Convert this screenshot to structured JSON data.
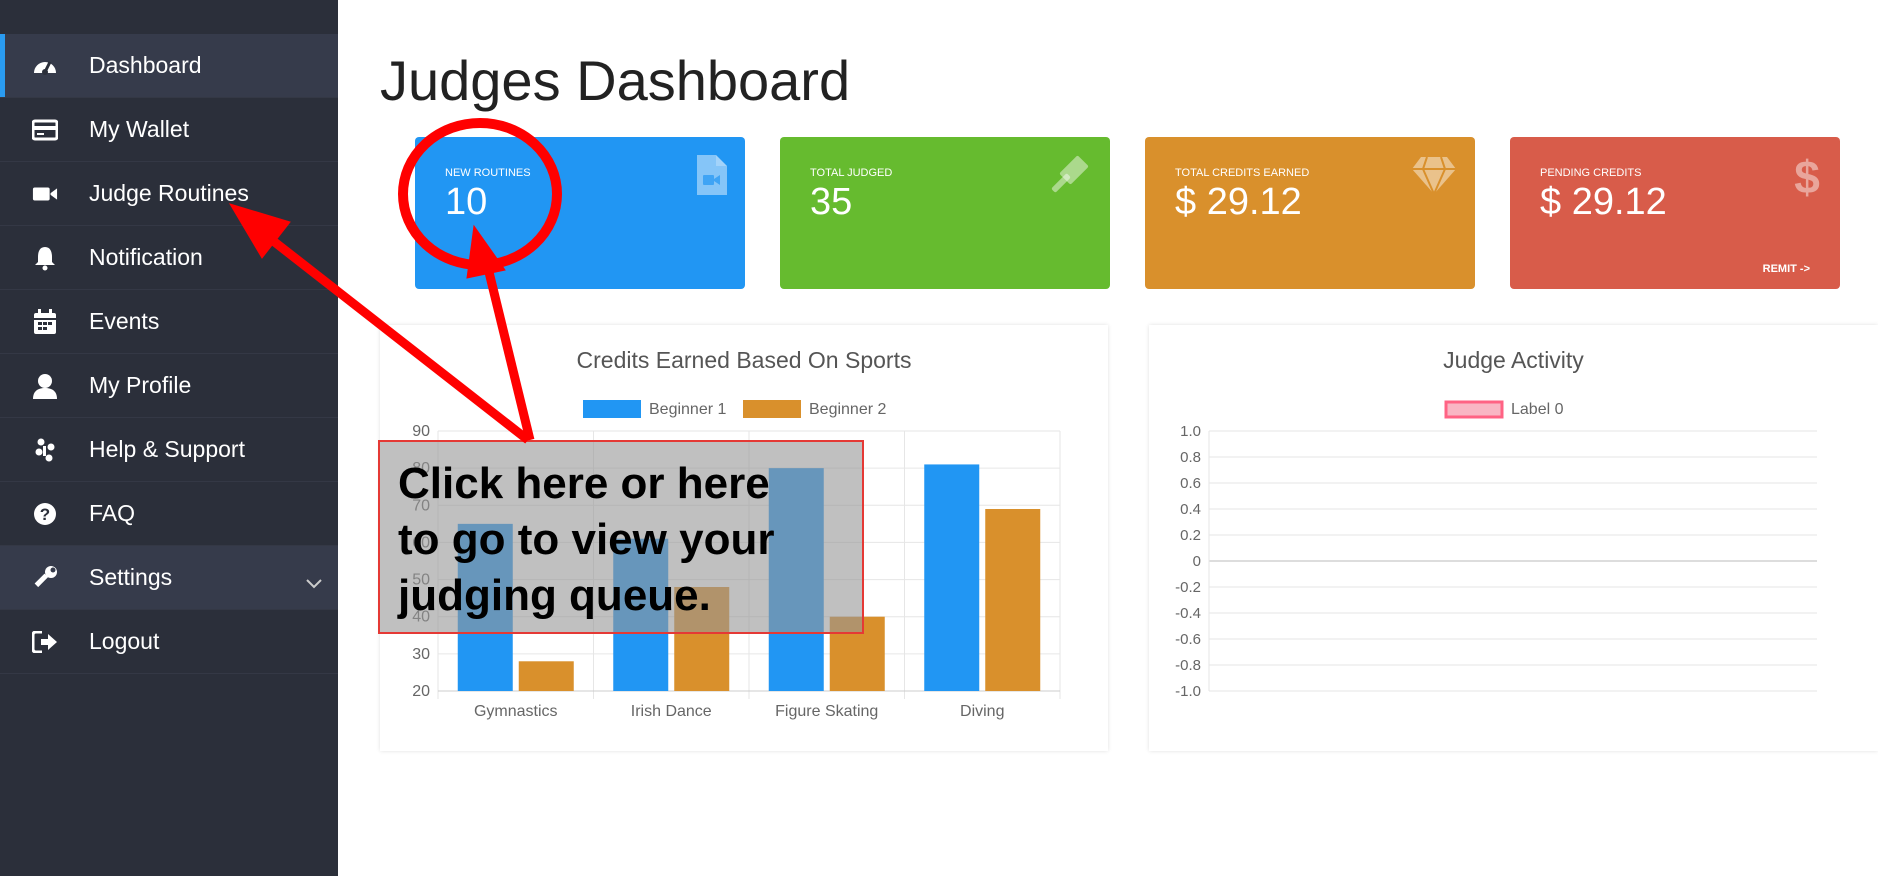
{
  "sidebar": {
    "items": [
      {
        "label": "Dashboard",
        "icon": "dashboard-icon"
      },
      {
        "label": "My Wallet",
        "icon": "wallet-icon"
      },
      {
        "label": "Judge Routines",
        "icon": "video-camera-icon"
      },
      {
        "label": "Notification",
        "icon": "bell-icon"
      },
      {
        "label": "Events",
        "icon": "calendar-icon"
      },
      {
        "label": "My Profile",
        "icon": "user-icon"
      },
      {
        "label": "Help & Support",
        "icon": "support-icon"
      },
      {
        "label": "FAQ",
        "icon": "question-icon"
      },
      {
        "label": "Settings",
        "icon": "wrench-icon"
      },
      {
        "label": "Logout",
        "icon": "logout-icon"
      }
    ]
  },
  "page": {
    "title": "Judges Dashboard"
  },
  "cards": [
    {
      "label": "NEW ROUTINES",
      "value": "10",
      "color": "#2196f3",
      "icon": "video-file-icon"
    },
    {
      "label": "TOTAL JUDGED",
      "value": "35",
      "color": "#66bb2f",
      "icon": "gavel-icon"
    },
    {
      "label": "TOTAL CREDITS EARNED",
      "value": "$ 29.12",
      "color": "#d9902c",
      "icon": "diamond-icon"
    },
    {
      "label": "PENDING CREDITS",
      "value": "$ 29.12",
      "color": "#d85c4a",
      "icon": "dollar-icon",
      "action": "REMIT ->"
    }
  ],
  "annotation": {
    "lines": [
      "Click here or here",
      "to go to view your",
      "judging queue."
    ]
  },
  "chart_data": [
    {
      "type": "bar",
      "title": "Credits Earned Based On Sports",
      "categories": [
        "Gymnastics",
        "Irish Dance",
        "Figure Skating",
        "Diving"
      ],
      "series": [
        {
          "name": "Beginner 1",
          "color": "#2196f3",
          "values": [
            65,
            61,
            80,
            81
          ]
        },
        {
          "name": "Beginner 2",
          "color": "#d9902c",
          "values": [
            28,
            48,
            40,
            69
          ]
        }
      ],
      "ylim": [
        20,
        90
      ],
      "yticks": [
        "20",
        "30",
        "40",
        "50",
        "60",
        "70",
        "80",
        "90"
      ],
      "grid": true,
      "legend": "top"
    },
    {
      "type": "line",
      "title": "Judge Activity",
      "series": [
        {
          "name": "Label 0",
          "color": "#ff6384",
          "values": []
        }
      ],
      "ylim": [
        -1.0,
        1.0
      ],
      "yticks": [
        "1.0",
        "0.8",
        "0.6",
        "0.4",
        "0.2",
        "0",
        "-0.2",
        "-0.4",
        "-0.6",
        "-0.8",
        "-1.0"
      ],
      "grid": true,
      "legend": "top"
    }
  ]
}
